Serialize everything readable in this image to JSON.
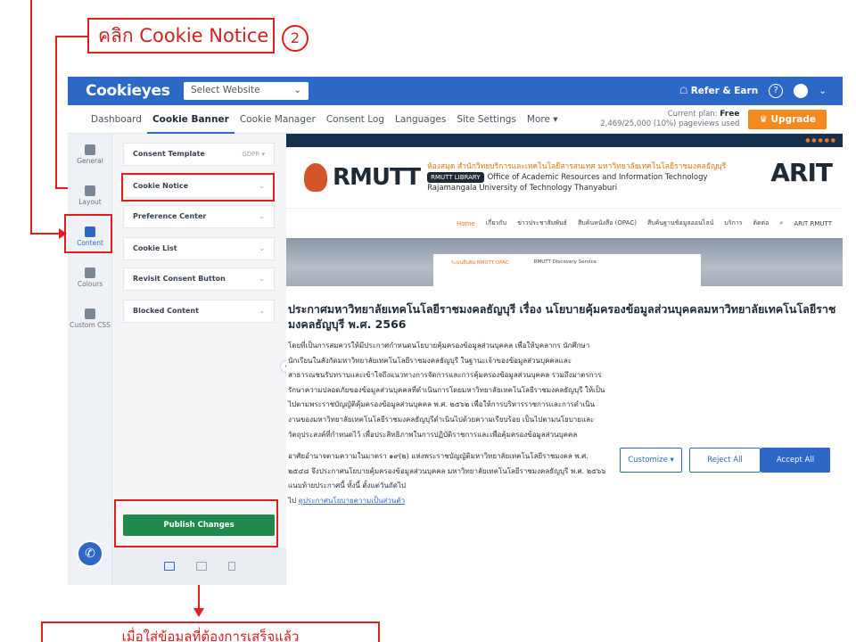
{
  "annotations": {
    "callout_top": "คลิก Cookie Notice",
    "step_number": "2",
    "callout_bottom": "เมื่อใส่ข้อมูลที่ต้องการเสร็จแล้ว"
  },
  "app": {
    "logo": "Cookieyes",
    "site_select": "Select Website",
    "refer": "Refer & Earn",
    "tabs": [
      "Dashboard",
      "Cookie Banner",
      "Cookie Manager",
      "Consent Log",
      "Languages",
      "Site Settings",
      "More ▾"
    ],
    "plan_label": "Current plan:",
    "plan_value": "Free",
    "pageviews": "2,469/25,000 (10%) pageviews used",
    "upgrade": "Upgrade"
  },
  "sidebar": {
    "items": [
      "General",
      "Layout",
      "Content",
      "Colours",
      "Custom CSS"
    ]
  },
  "panel": {
    "items": [
      {
        "label": "Consent Template",
        "extra": "GDPR ▾"
      },
      {
        "label": "Cookie Notice",
        "extra": "⌄"
      },
      {
        "label": "Preference Center",
        "extra": "⌄"
      },
      {
        "label": "Cookie List",
        "extra": "⌄"
      },
      {
        "label": "Revisit Consent Button",
        "extra": "⌄"
      },
      {
        "label": "Blocked Content",
        "extra": "⌄"
      }
    ],
    "publish": "Publish Changes"
  },
  "preview": {
    "brand": "RMUTT",
    "brand_thai": "ห้องสมุด สำนักวิทยบริการและเทคโนโลยีสารสนเทศ มหาวิทยาลัยเทคโนโลยีราชมงคลธัญบุรี",
    "brand_pill": "RMUTT LIBRARY",
    "brand_en1": "Office of Academic Resources and Information Technology",
    "brand_en2": "Rajamangala University of Technology Thanyaburi",
    "arit": "ARIT",
    "menu": [
      "Home",
      "เกี่ยวกับ",
      "ข่าวประชาสัมพันธ์",
      "สืบค้นหนังสือ (OPAC)",
      "สืบค้นฐานข้อมูลออนไลน์",
      "บริการ",
      "ติดต่อ",
      "ARIT RMUTT"
    ],
    "hero_tabs": [
      "ระบบสืบค้น RMUTT OPAC",
      "RMUTT Discovery Service"
    ]
  },
  "banner": {
    "title": "ประกาศมหาวิทยาลัยเทคโนโลยีราชมงคลธัญบุรี เรื่อง นโยบายคุ้มครองข้อมูลส่วนบุคคลมหาวิทยาลัยเทคโนโลยีราชมงคลธัญบุรี พ.ศ. 2566",
    "para1": "โดยที่เป็นการสมควรให้มีประกาศกำหนดนโยบายคุ้มครองข้อมูลส่วนบุคคล เพื่อให้บุคลากร นักศึกษา นักเรียนในสังกัดมหาวิทยาลัยเทคโนโลยีราชมงคลธัญบุรี ในฐานะเจ้าของข้อมูลส่วนบุคคลและสาธารณชนรับทราบและเข้าใจถึงแนวทางการจัดการและการคุ้มครองข้อมูลส่วนบุคคล รวมถึงมาตรการรักษาความปลอดภัยของข้อมูลส่วนบุคคลที่ดำเนินการโดยมหาวิทยาลัยเทคโนโลยีราชมงคลธัญบุรี ให้เป็นไปตามพระราชบัญญัติคุ้มครองข้อมูลส่วนบุคคล พ.ศ. ๒๕๖๒ เพื่อให้การบริหารราชการและการดำเนินงานของมหาวิทยาลัยเทคโนโลยีราชมงคลธัญบุรีดำเนินไปด้วยความเรียบร้อย เป็นไปตามนโยบายและวัตถุประสงค์ที่กำหนดไว้ เพื่อประสิทธิภาพในการปฏิบัติราชการและเพื่อคุ้มครองข้อมูลส่วนบุคคล",
    "para2": "อาศัยอำนาจตามความในมาตรา ๑๙(๒) แห่งพระราชบัญญัติมหาวิทยาลัยเทคโนโลยีราชมงคล พ.ศ. ๒๕๔๘ จึงประกาศนโยบายคุ้มครองข้อมูลส่วนบุคคล มหาวิทยาลัยเทคโนโลยีราชมงคลธัญบุรี พ.ศ. ๒๕๖๖ แนบท้ายประกาศนี้ ทั้งนี้ ตั้งแต่วันถัดไป",
    "link_prefix": "ไป ",
    "link": "ดูประกาศนโยบายความเป็นส่วนตัว",
    "customize": "Customize ▾",
    "reject": "Reject All",
    "accept": "Accept All"
  },
  "colors": {
    "accent": "#2d68c6",
    "annotation": "#e11d1d",
    "publish": "#1e8a4c",
    "upgrade": "#f4891f"
  }
}
